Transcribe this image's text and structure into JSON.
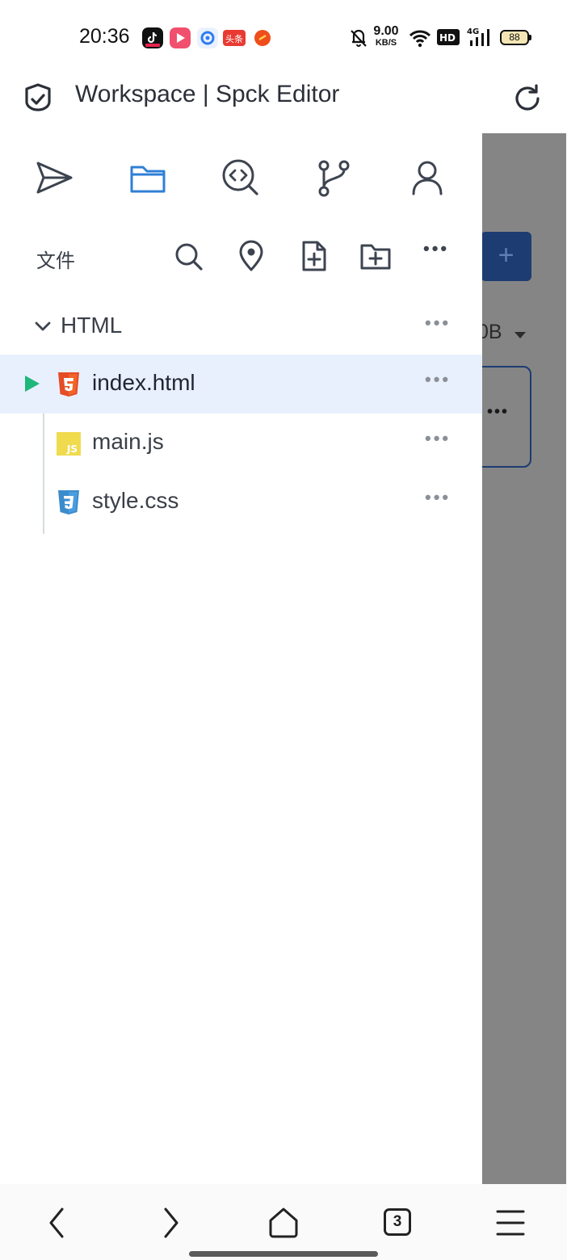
{
  "status_bar": {
    "time": "20:36",
    "notifications": [
      {
        "icon": "tiktok-icon",
        "color": "#111111"
      },
      {
        "icon": "video-app-icon",
        "color": "#f0506e"
      },
      {
        "icon": "qq-browser-icon",
        "color": "#2f7cf6"
      },
      {
        "icon": "toutiao-icon",
        "color": "#e83a33",
        "text": "头条"
      },
      {
        "icon": "taobao-special-icon",
        "color": "#f04d1d"
      }
    ],
    "net_speed_value": "9.00",
    "net_speed_unit": "KB/S",
    "hd_label": "HD",
    "network_label": "4G",
    "battery": "88"
  },
  "title_bar": {
    "title": "Workspace | Spck Editor",
    "left_icon": "shield-check-icon",
    "right_icon": "reload-icon"
  },
  "drawer": {
    "nav": [
      {
        "icon": "send-icon",
        "active": false
      },
      {
        "icon": "folder-icon",
        "active": true
      },
      {
        "icon": "code-search-icon",
        "active": false
      },
      {
        "icon": "git-branch-icon",
        "active": false
      },
      {
        "icon": "user-icon",
        "active": false
      }
    ],
    "files_label": "文件",
    "toolbar": [
      "search-icon",
      "locate-icon",
      "new-file-icon",
      "new-folder-icon",
      "more-icon"
    ],
    "folder": {
      "name": "HTML",
      "expanded": true
    },
    "files": [
      {
        "name": "index.html",
        "type": "html",
        "active": true
      },
      {
        "name": "main.js",
        "type": "js",
        "active": false
      },
      {
        "name": "style.css",
        "type": "css",
        "active": false
      }
    ],
    "js_badge": "JS"
  },
  "backdrop": {
    "plus_label": "+",
    "partial_text": "0B"
  },
  "system_nav": {
    "tab_count": "3"
  },
  "colors": {
    "accent": "#2f7fd6",
    "active_row": "#e9f0fd",
    "run_green": "#1fb77a",
    "html_orange": "#e44d26",
    "js_yellow": "#f0db4f",
    "css_blue": "#3c8ccc",
    "backdrop": "#858585",
    "button_navy": "#1d3c72"
  }
}
